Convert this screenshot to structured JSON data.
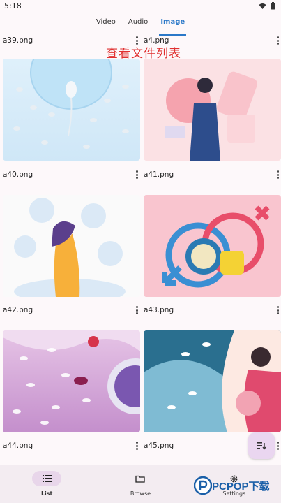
{
  "status_bar": {
    "time": "5:18"
  },
  "tabs": [
    {
      "label": "Video",
      "active": false
    },
    {
      "label": "Audio",
      "active": false
    },
    {
      "label": "Image",
      "active": true
    }
  ],
  "overlay_text": "查看文件列表",
  "files": [
    {
      "name": "a39.png"
    },
    {
      "name": "a4.png"
    },
    {
      "name": "a40.png"
    },
    {
      "name": "a41.png"
    },
    {
      "name": "a42.png"
    },
    {
      "name": "a43.png"
    },
    {
      "name": "a44.png"
    },
    {
      "name": "a45.png"
    }
  ],
  "bottom_nav": [
    {
      "label": "List",
      "active": true,
      "icon": "list-icon"
    },
    {
      "label": "Browse",
      "active": false,
      "icon": "folder-icon"
    },
    {
      "label": "Settings",
      "active": false,
      "icon": "gear-icon"
    }
  ],
  "watermark": {
    "text": "PCPOP下载"
  },
  "colors": {
    "accent": "#2a78c8",
    "overlay_text": "#e03030",
    "fab": "#ead6f0"
  }
}
